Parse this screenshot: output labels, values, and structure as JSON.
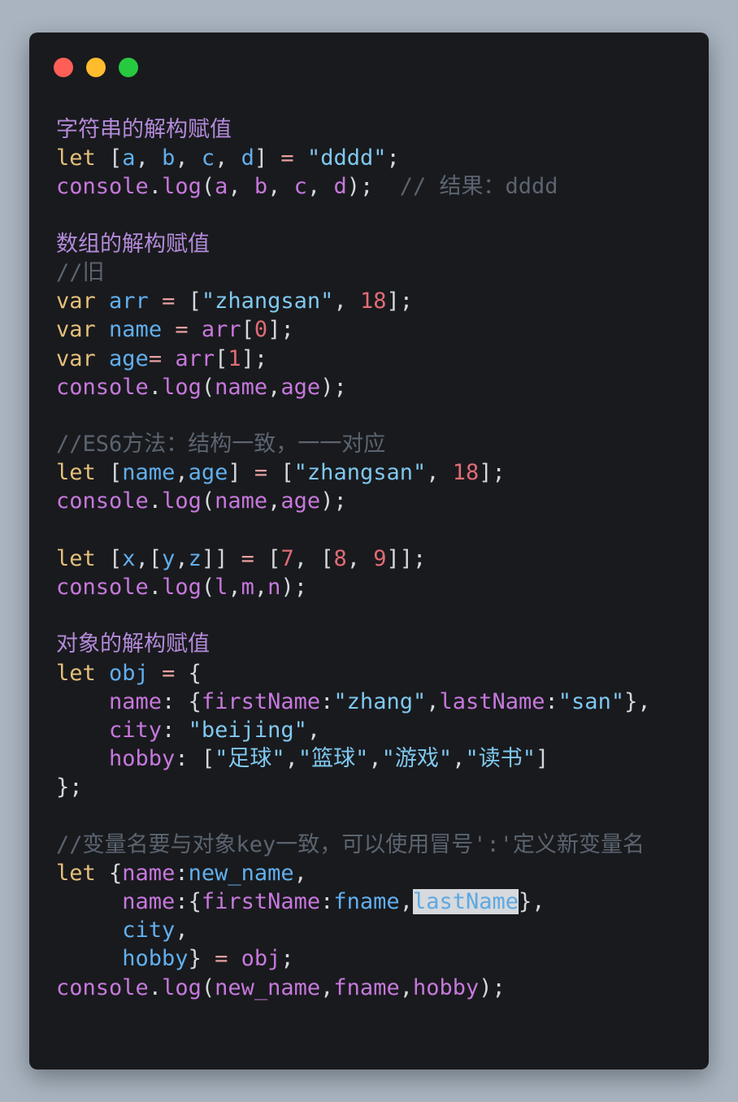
{
  "window": {
    "controls": [
      {
        "name": "close-button",
        "color": "#ff5f56"
      },
      {
        "name": "minimize-button",
        "color": "#ffbd2e"
      },
      {
        "name": "maximize-button",
        "color": "#27c93f"
      }
    ]
  },
  "colors": {
    "keyword": "#e5c07b",
    "variable": "#61afef",
    "property": "#c678dd",
    "string": "#7fc8f0",
    "number": "#e06c75",
    "comment": "#5b6470",
    "heading": "#b38ad9",
    "background": "#191a1d",
    "page": "#a9b4c0"
  },
  "code": {
    "lines": [
      [
        {
          "t": "字符串的解构赋值",
          "k": "h"
        }
      ],
      [
        {
          "t": "let",
          "k": "kw"
        },
        {
          "t": " [",
          "k": "pl"
        },
        {
          "t": "a",
          "k": "v"
        },
        {
          "t": ", ",
          "k": "pl"
        },
        {
          "t": "b",
          "k": "v"
        },
        {
          "t": ", ",
          "k": "pl"
        },
        {
          "t": "c",
          "k": "v"
        },
        {
          "t": ", ",
          "k": "pl"
        },
        {
          "t": "d",
          "k": "v"
        },
        {
          "t": "] ",
          "k": "pl"
        },
        {
          "t": "=",
          "k": "o"
        },
        {
          "t": " ",
          "k": "pl"
        },
        {
          "t": "\"dddd\"",
          "k": "s"
        },
        {
          "t": ";",
          "k": "pl"
        }
      ],
      [
        {
          "t": "console",
          "k": "p"
        },
        {
          "t": ".",
          "k": "pl"
        },
        {
          "t": "log",
          "k": "p"
        },
        {
          "t": "(",
          "k": "pl"
        },
        {
          "t": "a",
          "k": "p"
        },
        {
          "t": ", ",
          "k": "pl"
        },
        {
          "t": "b",
          "k": "p"
        },
        {
          "t": ", ",
          "k": "pl"
        },
        {
          "t": "c",
          "k": "p"
        },
        {
          "t": ", ",
          "k": "pl"
        },
        {
          "t": "d",
          "k": "p"
        },
        {
          "t": ");  ",
          "k": "pl"
        },
        {
          "t": "// 结果：dddd",
          "k": "c"
        }
      ],
      [],
      [
        {
          "t": "数组的解构赋值",
          "k": "h"
        }
      ],
      [
        {
          "t": "//旧",
          "k": "c"
        }
      ],
      [
        {
          "t": "var",
          "k": "kw"
        },
        {
          "t": " ",
          "k": "pl"
        },
        {
          "t": "arr",
          "k": "v"
        },
        {
          "t": " ",
          "k": "pl"
        },
        {
          "t": "=",
          "k": "o"
        },
        {
          "t": " [",
          "k": "pl"
        },
        {
          "t": "\"zhangsan\"",
          "k": "s"
        },
        {
          "t": ", ",
          "k": "pl"
        },
        {
          "t": "18",
          "k": "n"
        },
        {
          "t": "];",
          "k": "pl"
        }
      ],
      [
        {
          "t": "var",
          "k": "kw"
        },
        {
          "t": " ",
          "k": "pl"
        },
        {
          "t": "name",
          "k": "v"
        },
        {
          "t": " ",
          "k": "pl"
        },
        {
          "t": "=",
          "k": "o"
        },
        {
          "t": " ",
          "k": "pl"
        },
        {
          "t": "arr",
          "k": "p"
        },
        {
          "t": "[",
          "k": "pl"
        },
        {
          "t": "0",
          "k": "n"
        },
        {
          "t": "];",
          "k": "pl"
        }
      ],
      [
        {
          "t": "var",
          "k": "kw"
        },
        {
          "t": " ",
          "k": "pl"
        },
        {
          "t": "age",
          "k": "v"
        },
        {
          "t": "=",
          "k": "o"
        },
        {
          "t": " ",
          "k": "pl"
        },
        {
          "t": "arr",
          "k": "p"
        },
        {
          "t": "[",
          "k": "pl"
        },
        {
          "t": "1",
          "k": "n"
        },
        {
          "t": "];",
          "k": "pl"
        }
      ],
      [
        {
          "t": "console",
          "k": "p"
        },
        {
          "t": ".",
          "k": "pl"
        },
        {
          "t": "log",
          "k": "p"
        },
        {
          "t": "(",
          "k": "pl"
        },
        {
          "t": "name",
          "k": "p"
        },
        {
          "t": ",",
          "k": "pl"
        },
        {
          "t": "age",
          "k": "p"
        },
        {
          "t": ");",
          "k": "pl"
        }
      ],
      [],
      [
        {
          "t": "//ES6方法：结构一致，一一对应",
          "k": "c"
        }
      ],
      [
        {
          "t": "let",
          "k": "kw"
        },
        {
          "t": " [",
          "k": "pl"
        },
        {
          "t": "name",
          "k": "v"
        },
        {
          "t": ",",
          "k": "pl"
        },
        {
          "t": "age",
          "k": "v"
        },
        {
          "t": "] ",
          "k": "pl"
        },
        {
          "t": "=",
          "k": "o"
        },
        {
          "t": " [",
          "k": "pl"
        },
        {
          "t": "\"zhangsan\"",
          "k": "s"
        },
        {
          "t": ", ",
          "k": "pl"
        },
        {
          "t": "18",
          "k": "n"
        },
        {
          "t": "];",
          "k": "pl"
        }
      ],
      [
        {
          "t": "console",
          "k": "p"
        },
        {
          "t": ".",
          "k": "pl"
        },
        {
          "t": "log",
          "k": "p"
        },
        {
          "t": "(",
          "k": "pl"
        },
        {
          "t": "name",
          "k": "p"
        },
        {
          "t": ",",
          "k": "pl"
        },
        {
          "t": "age",
          "k": "p"
        },
        {
          "t": ");",
          "k": "pl"
        }
      ],
      [],
      [
        {
          "t": "let",
          "k": "kw"
        },
        {
          "t": " [",
          "k": "pl"
        },
        {
          "t": "x",
          "k": "v"
        },
        {
          "t": ",[",
          "k": "pl"
        },
        {
          "t": "y",
          "k": "v"
        },
        {
          "t": ",",
          "k": "pl"
        },
        {
          "t": "z",
          "k": "v"
        },
        {
          "t": "]] ",
          "k": "pl"
        },
        {
          "t": "=",
          "k": "o"
        },
        {
          "t": " [",
          "k": "pl"
        },
        {
          "t": "7",
          "k": "n"
        },
        {
          "t": ", [",
          "k": "pl"
        },
        {
          "t": "8",
          "k": "n"
        },
        {
          "t": ", ",
          "k": "pl"
        },
        {
          "t": "9",
          "k": "n"
        },
        {
          "t": "]];",
          "k": "pl"
        }
      ],
      [
        {
          "t": "console",
          "k": "p"
        },
        {
          "t": ".",
          "k": "pl"
        },
        {
          "t": "log",
          "k": "p"
        },
        {
          "t": "(",
          "k": "pl"
        },
        {
          "t": "l",
          "k": "p"
        },
        {
          "t": ",",
          "k": "pl"
        },
        {
          "t": "m",
          "k": "p"
        },
        {
          "t": ",",
          "k": "pl"
        },
        {
          "t": "n",
          "k": "p"
        },
        {
          "t": ");",
          "k": "pl"
        }
      ],
      [],
      [
        {
          "t": "对象的解构赋值",
          "k": "h"
        }
      ],
      [
        {
          "t": "let",
          "k": "kw"
        },
        {
          "t": " ",
          "k": "pl"
        },
        {
          "t": "obj",
          "k": "v"
        },
        {
          "t": " ",
          "k": "pl"
        },
        {
          "t": "=",
          "k": "o"
        },
        {
          "t": " {",
          "k": "pl"
        }
      ],
      [
        {
          "t": "    ",
          "k": "pl"
        },
        {
          "t": "name",
          "k": "p"
        },
        {
          "t": ": {",
          "k": "pl"
        },
        {
          "t": "firstName",
          "k": "p"
        },
        {
          "t": ":",
          "k": "pl"
        },
        {
          "t": "\"zhang\"",
          "k": "s"
        },
        {
          "t": ",",
          "k": "pl"
        },
        {
          "t": "lastName",
          "k": "p"
        },
        {
          "t": ":",
          "k": "pl"
        },
        {
          "t": "\"san\"",
          "k": "s"
        },
        {
          "t": "},",
          "k": "pl"
        }
      ],
      [
        {
          "t": "    ",
          "k": "pl"
        },
        {
          "t": "city",
          "k": "p"
        },
        {
          "t": ": ",
          "k": "pl"
        },
        {
          "t": "\"beijing\"",
          "k": "s"
        },
        {
          "t": ",",
          "k": "pl"
        }
      ],
      [
        {
          "t": "    ",
          "k": "pl"
        },
        {
          "t": "hobby",
          "k": "p"
        },
        {
          "t": ": [",
          "k": "pl"
        },
        {
          "t": "\"足球\"",
          "k": "s"
        },
        {
          "t": ",",
          "k": "pl"
        },
        {
          "t": "\"篮球\"",
          "k": "s"
        },
        {
          "t": ",",
          "k": "pl"
        },
        {
          "t": "\"游戏\"",
          "k": "s"
        },
        {
          "t": ",",
          "k": "pl"
        },
        {
          "t": "\"读书\"",
          "k": "s"
        },
        {
          "t": "]",
          "k": "pl"
        }
      ],
      [
        {
          "t": "};",
          "k": "pl"
        }
      ],
      [],
      [
        {
          "t": "//变量名要与对象key一致，可以使用冒号':'定义新变量名",
          "k": "c"
        }
      ],
      [
        {
          "t": "let",
          "k": "kw"
        },
        {
          "t": " {",
          "k": "pl"
        },
        {
          "t": "name",
          "k": "p"
        },
        {
          "t": ":",
          "k": "pl"
        },
        {
          "t": "new_name",
          "k": "v"
        },
        {
          "t": ",",
          "k": "pl"
        }
      ],
      [
        {
          "t": "     ",
          "k": "pl"
        },
        {
          "t": "name",
          "k": "p"
        },
        {
          "t": ":{",
          "k": "pl"
        },
        {
          "t": "firstName",
          "k": "p"
        },
        {
          "t": ":",
          "k": "pl"
        },
        {
          "t": "fname",
          "k": "v"
        },
        {
          "t": ",",
          "k": "pl"
        },
        {
          "t": "lastName",
          "k": "sel"
        },
        {
          "t": "},",
          "k": "pl"
        }
      ],
      [
        {
          "t": "     ",
          "k": "pl"
        },
        {
          "t": "city",
          "k": "v"
        },
        {
          "t": ",",
          "k": "pl"
        }
      ],
      [
        {
          "t": "     ",
          "k": "pl"
        },
        {
          "t": "hobby",
          "k": "v"
        },
        {
          "t": "} ",
          "k": "pl"
        },
        {
          "t": "=",
          "k": "o"
        },
        {
          "t": " ",
          "k": "pl"
        },
        {
          "t": "obj",
          "k": "p"
        },
        {
          "t": ";",
          "k": "pl"
        }
      ],
      [
        {
          "t": "console",
          "k": "p"
        },
        {
          "t": ".",
          "k": "pl"
        },
        {
          "t": "log",
          "k": "p"
        },
        {
          "t": "(",
          "k": "pl"
        },
        {
          "t": "new_name",
          "k": "p"
        },
        {
          "t": ",",
          "k": "pl"
        },
        {
          "t": "fname",
          "k": "p"
        },
        {
          "t": ",",
          "k": "pl"
        },
        {
          "t": "hobby",
          "k": "p"
        },
        {
          "t": ");",
          "k": "pl"
        }
      ]
    ]
  }
}
